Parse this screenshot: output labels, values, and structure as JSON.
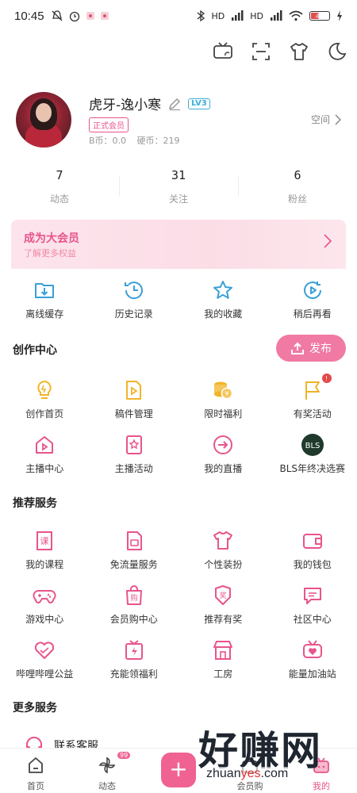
{
  "status_bar": {
    "time": "10:45",
    "battery": "42",
    "network_labels": [
      "HD",
      "HD"
    ]
  },
  "top_icons": [
    "tv-icon",
    "scan-icon",
    "tshirt-icon",
    "moon-icon"
  ],
  "profile": {
    "username": "虎牙-逸小寒",
    "level": "LV3",
    "vip_badge": "正式会员",
    "b_coins": "B币：0.0",
    "hard_coins": "硬币：219",
    "space_link": "空间"
  },
  "stats": [
    {
      "value": "7",
      "label": "动态"
    },
    {
      "value": "31",
      "label": "关注"
    },
    {
      "value": "6",
      "label": "粉丝"
    }
  ],
  "vip_banner": {
    "title": "成为大会员",
    "subtitle": "了解更多权益"
  },
  "quick_actions": [
    {
      "label": "离线缓存",
      "icon": "download-folder-icon"
    },
    {
      "label": "历史记录",
      "icon": "history-icon"
    },
    {
      "label": "我的收藏",
      "icon": "star-icon"
    },
    {
      "label": "稍后再看",
      "icon": "play-later-icon"
    }
  ],
  "creation_center": {
    "title": "创作中心",
    "publish_label": "发布",
    "items": [
      {
        "label": "创作首页",
        "icon": "bulb-icon"
      },
      {
        "label": "稿件管理",
        "icon": "document-play-icon"
      },
      {
        "label": "限时福利",
        "icon": "coins-icon"
      },
      {
        "label": "有奖活动",
        "icon": "flag-icon",
        "badge": "!"
      },
      {
        "label": "主播中心",
        "icon": "home-play-icon"
      },
      {
        "label": "主播活动",
        "icon": "star-card-icon"
      },
      {
        "label": "我的直播",
        "icon": "arrow-circle-icon"
      },
      {
        "label": "BLS年终决选赛",
        "icon": "bls-logo-icon",
        "logo_text": "BLS"
      }
    ]
  },
  "recommended_services": {
    "title": "推荐服务",
    "items": [
      {
        "label": "我的课程",
        "icon": "course-icon",
        "glyph": "课"
      },
      {
        "label": "免流量服务",
        "icon": "sim-card-icon"
      },
      {
        "label": "个性装扮",
        "icon": "tshirt-icon"
      },
      {
        "label": "我的钱包",
        "icon": "wallet-icon"
      },
      {
        "label": "游戏中心",
        "icon": "gamepad-icon"
      },
      {
        "label": "会员购中心",
        "icon": "shopping-bag-icon",
        "glyph": "购"
      },
      {
        "label": "推荐有奖",
        "icon": "award-icon",
        "glyph": "奖"
      },
      {
        "label": "社区中心",
        "icon": "chat-icon"
      },
      {
        "label": "哔哩哔哩公益",
        "icon": "heart-icon"
      },
      {
        "label": "充能领福利",
        "icon": "gift-bolt-icon"
      },
      {
        "label": "工房",
        "icon": "shop-icon"
      },
      {
        "label": "能量加油站",
        "icon": "tv-heart-icon"
      }
    ]
  },
  "more_services": {
    "title": "更多服务",
    "contact": "联系客服"
  },
  "tab_bar": [
    {
      "label": "首页",
      "icon": "home-icon"
    },
    {
      "label": "动态",
      "icon": "pinwheel-icon",
      "badge": "99"
    },
    {
      "label": "",
      "icon": "plus-icon"
    },
    {
      "label": "会员购",
      "icon": "shop-tv-icon"
    },
    {
      "label": "我的",
      "icon": "tv-face-icon"
    }
  ],
  "watermark": {
    "big": "好赚网",
    "small_a": "zhuan",
    "small_b": "yes",
    "small_c": ".com"
  },
  "colors": {
    "accent": "#e8548c",
    "icon_blue": "#3a9fd8",
    "icon_yellow": "#f0b429",
    "badge_red": "#e44848"
  }
}
